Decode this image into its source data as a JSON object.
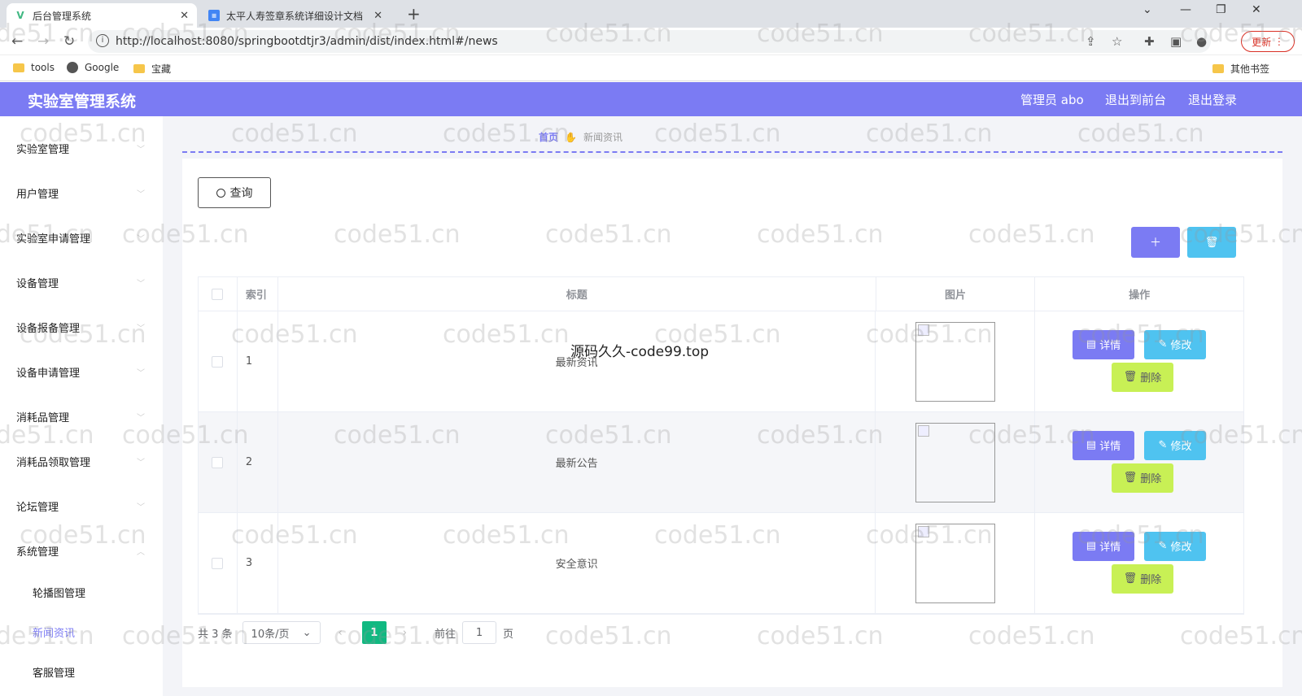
{
  "browser": {
    "tabs": [
      {
        "title": "后台管理系统",
        "favicon": "V"
      },
      {
        "title": "太平人寿签章系统详细设计文档",
        "favicon": "doc"
      }
    ],
    "url": "http://localhost:8080/springbootdtjr3/admin/dist/index.html#/news",
    "update_label": "更新",
    "bookmarks": [
      "tools",
      "Google",
      "宝藏"
    ],
    "other_bookmarks": "其他书签"
  },
  "header": {
    "title": "实验室管理系统",
    "user": "管理员 abo",
    "back_front": "退出到前台",
    "logout": "退出登录",
    "accent": "#7b7bf3"
  },
  "sidebar": {
    "items": [
      "实验室管理",
      "用户管理",
      "实验室申请管理",
      "设备管理",
      "设备报备管理",
      "设备申请管理",
      "消耗品管理",
      "消耗品领取管理",
      "论坛管理",
      "系统管理"
    ],
    "subitems": [
      "轮播图管理",
      "新闻资讯",
      "客服管理"
    ]
  },
  "breadcrumb": {
    "home": "首页",
    "current": "新闻资讯"
  },
  "query_label": "查询",
  "table": {
    "headers": [
      "索引",
      "标题",
      "图片",
      "操作"
    ],
    "rows": [
      {
        "index": "1",
        "title": "最新资讯"
      },
      {
        "index": "2",
        "title": "最新公告"
      },
      {
        "index": "3",
        "title": "安全意识"
      }
    ],
    "ops": {
      "detail": "详情",
      "edit": "修改",
      "delete": "删除"
    }
  },
  "pager": {
    "total": "共 3 条",
    "size": "10条/页",
    "page": "1",
    "goto": "前往",
    "goto_value": "1",
    "page_unit": "页"
  },
  "watermark": "code51.cn",
  "overlay_text": "源码久久-code99.top"
}
